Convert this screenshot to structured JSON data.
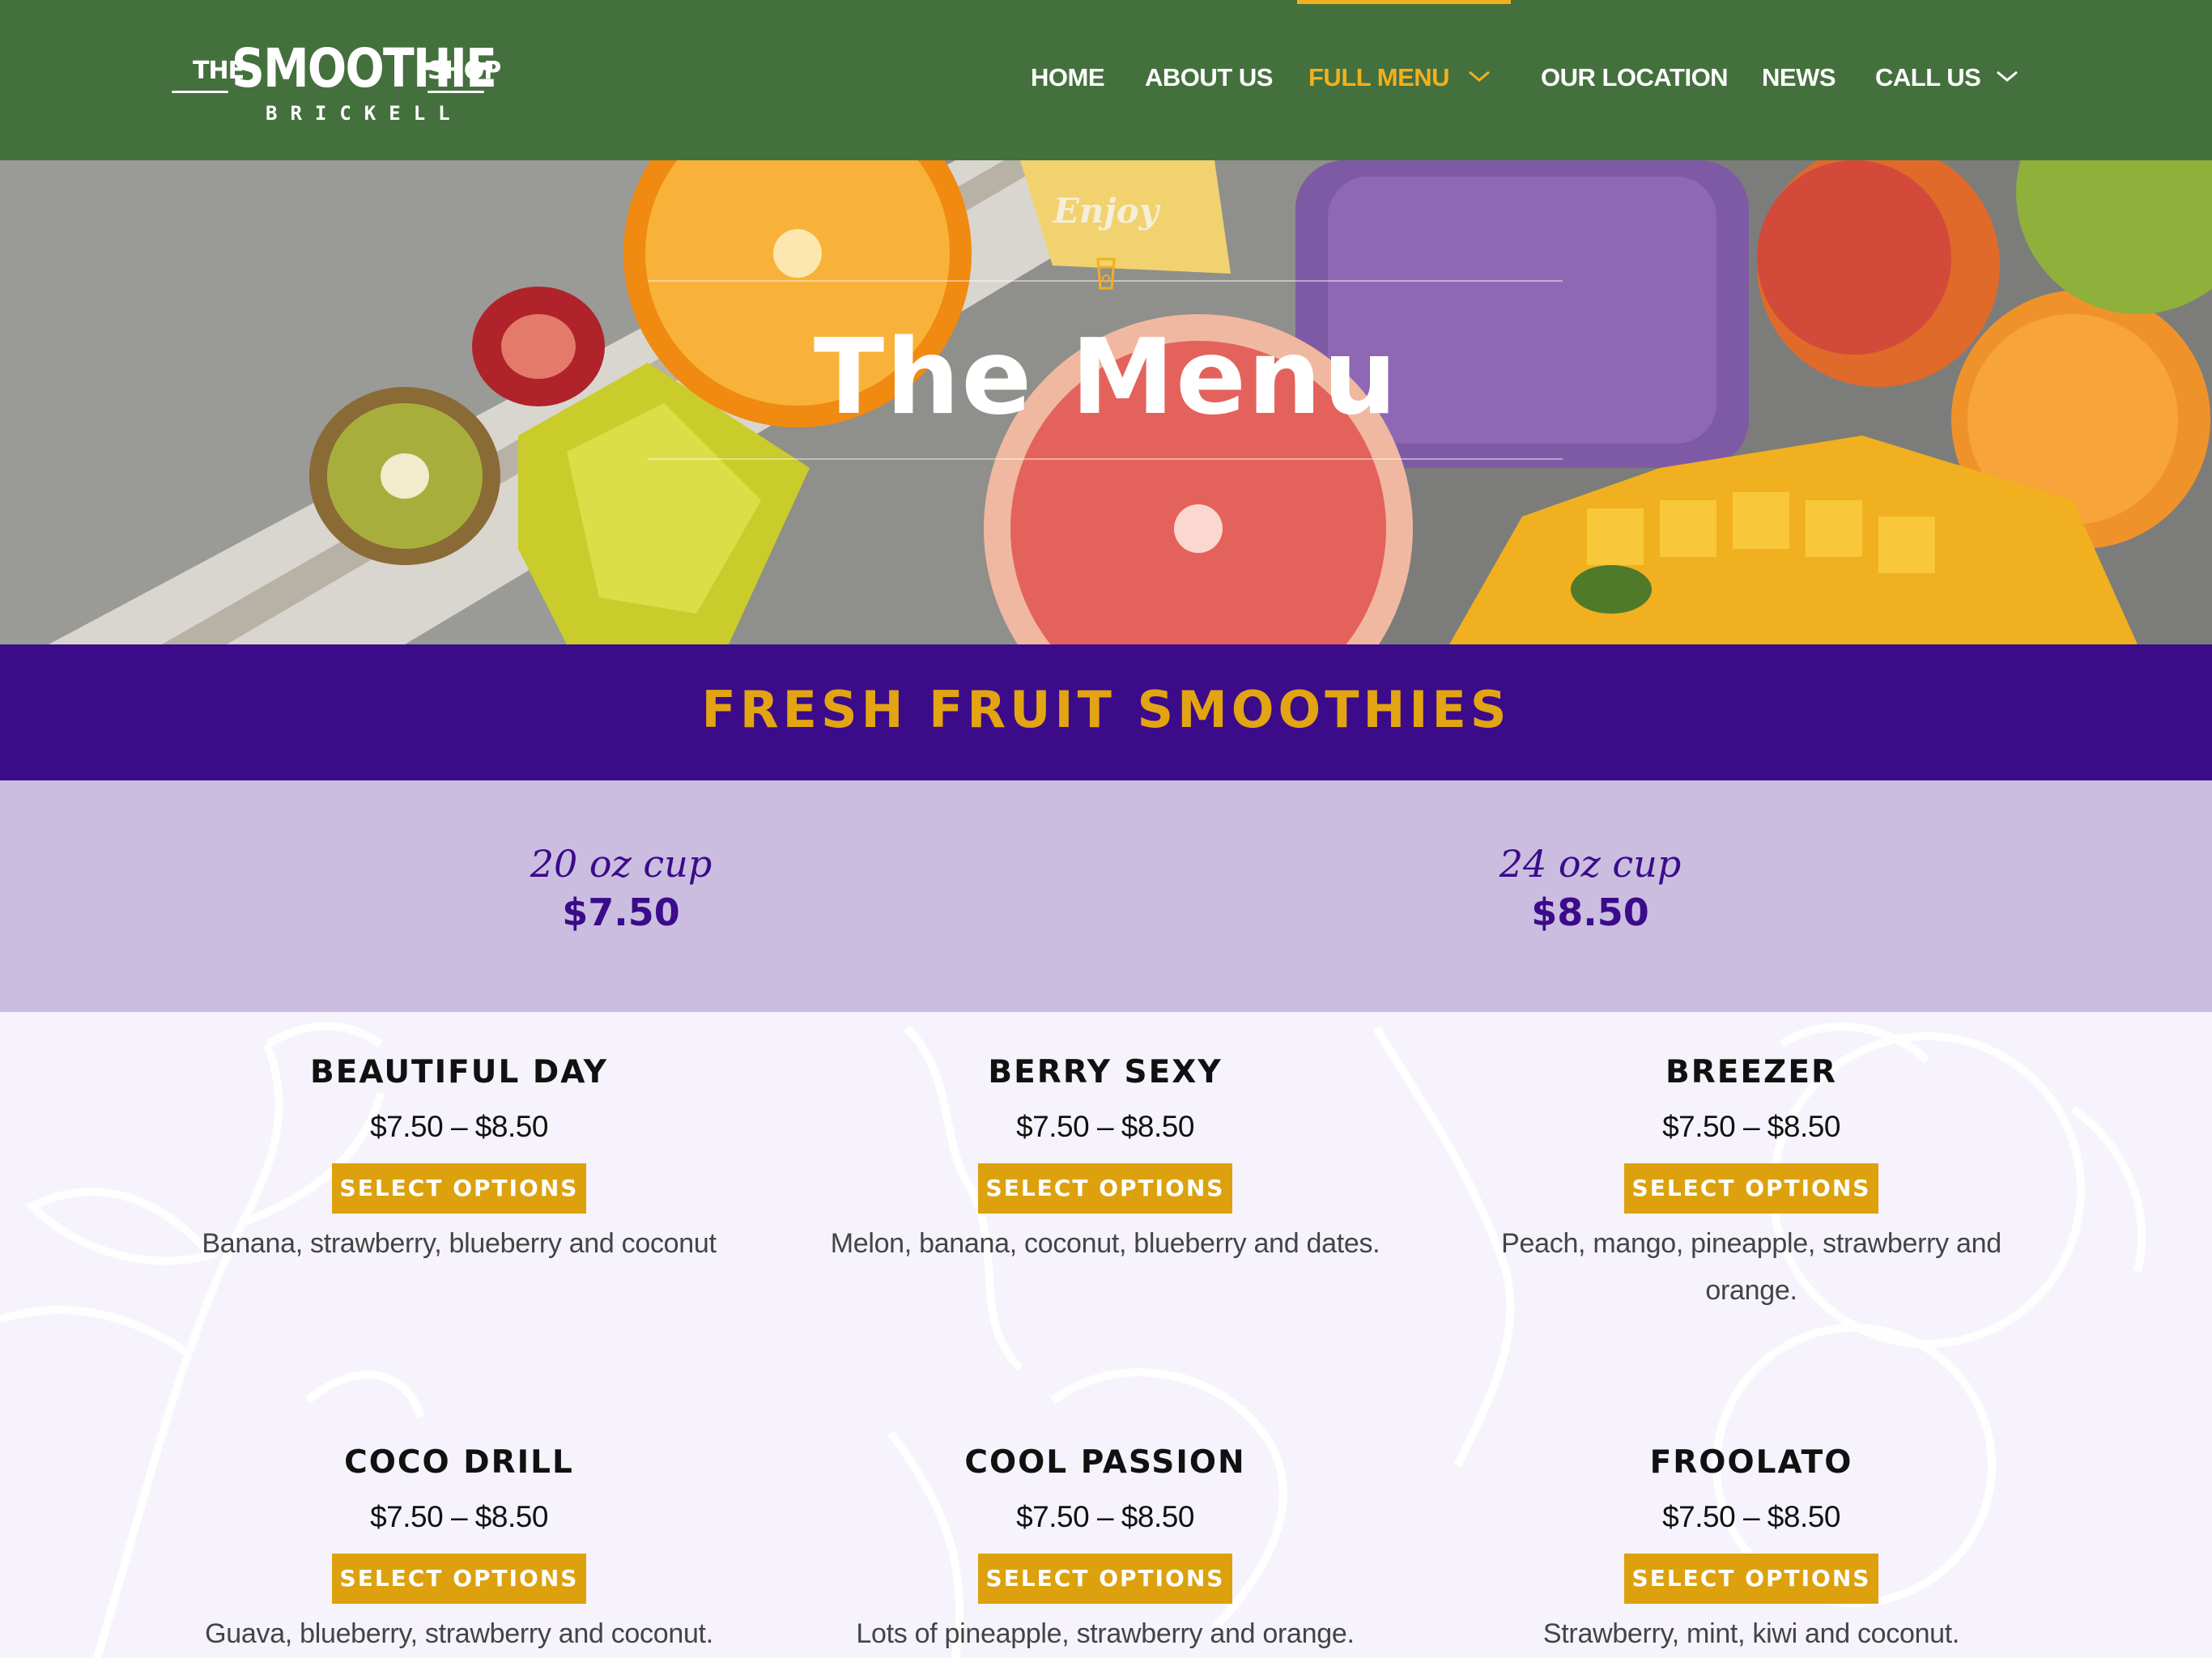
{
  "logo": {
    "the": "THE",
    "main": "SMOOTHIE",
    "shop": "SHOP",
    "sub": "BRICKELL"
  },
  "nav": {
    "home": "HOME",
    "about": "ABOUT US",
    "full_menu": "FULL MENU",
    "location": "OUR LOCATION",
    "news": "NEWS",
    "call": "CALL US"
  },
  "hero": {
    "kicker": "Enjoy",
    "title": "The Menu"
  },
  "section": {
    "title": "FRESH FRUIT SMOOTHIES"
  },
  "sizes": [
    {
      "label": "20 oz cup",
      "price": "$7.50"
    },
    {
      "label": "24 oz cup",
      "price": "$8.50"
    }
  ],
  "products": [
    {
      "name": "BEAUTIFUL DAY",
      "price": "$7.50 – $8.50",
      "button": "SELECT OPTIONS",
      "description": "Banana, strawberry, blueberry and coconut"
    },
    {
      "name": "BERRY SEXY",
      "price": "$7.50 – $8.50",
      "button": "SELECT OPTIONS",
      "description": "Melon, banana, coconut, blueberry and dates."
    },
    {
      "name": "BREEZER",
      "price": "$7.50 – $8.50",
      "button": "SELECT OPTIONS",
      "description": "Peach, mango, pineapple, strawberry and orange."
    },
    {
      "name": "COCO DRILL",
      "price": "$7.50 – $8.50",
      "button": "SELECT OPTIONS",
      "description": "Guava, blueberry, strawberry and coconut."
    },
    {
      "name": "COOL PASSION",
      "price": "$7.50 – $8.50",
      "button": "SELECT OPTIONS",
      "description": "Lots of pineapple, strawberry and orange."
    },
    {
      "name": "FROOLATO",
      "price": "$7.50 – $8.50",
      "button": "SELECT OPTIONS",
      "description": "Strawberry, mint, kiwi and coconut."
    }
  ],
  "colors": {
    "header_green": "#44703d",
    "accent_gold": "#f2b01e",
    "button_gold": "#dca10d",
    "purple": "#3b0b8a",
    "lavender": "#cbbde0"
  }
}
